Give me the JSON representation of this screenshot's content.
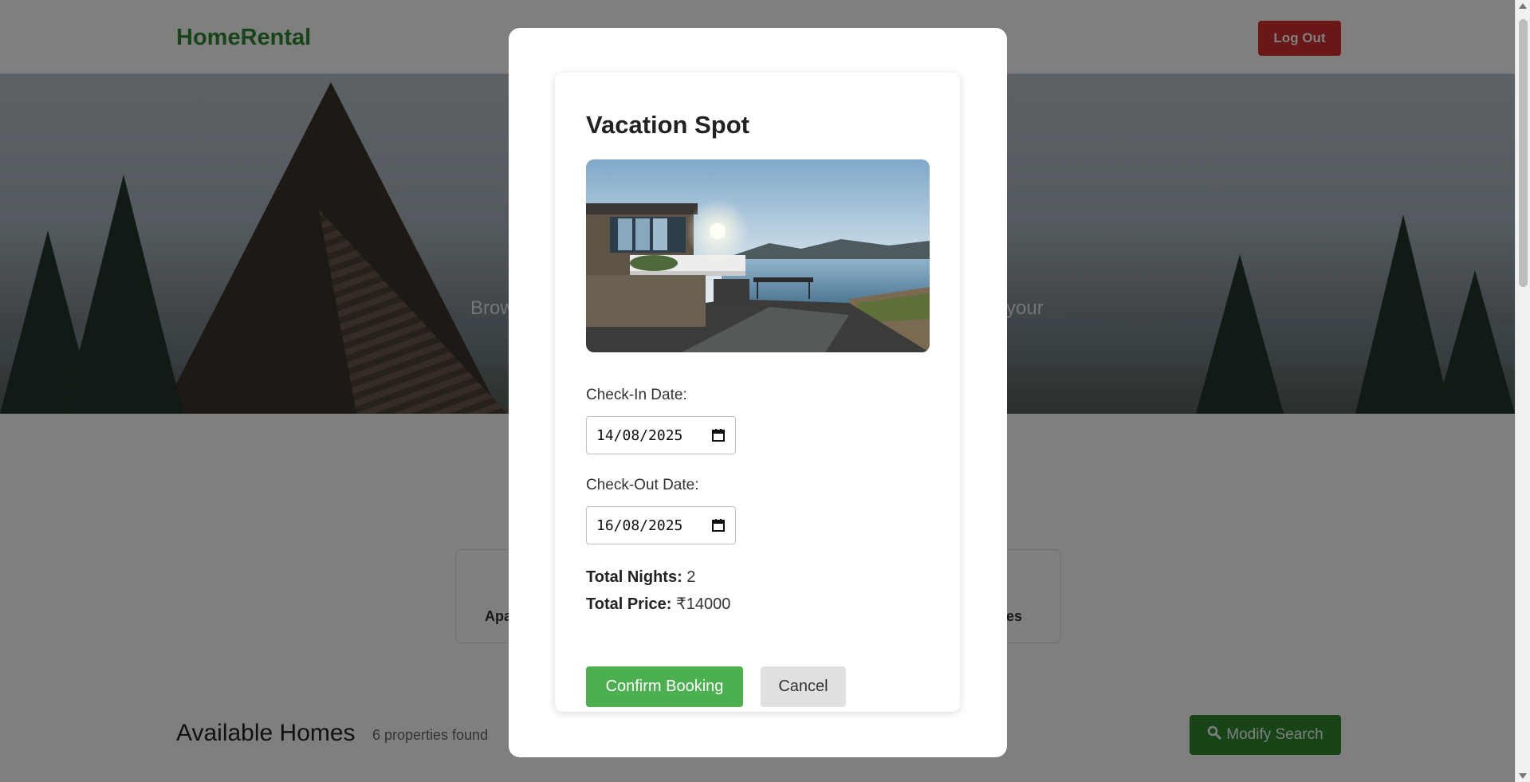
{
  "navbar": {
    "brand": "HomeRental",
    "logout_label": "Log Out"
  },
  "hero": {
    "text_left": "Brow",
    "text_right": "your"
  },
  "categories": {
    "left_label": "Apa",
    "right_label": "es"
  },
  "listing": {
    "title": "Available Homes",
    "count": "6 properties found",
    "modify_label": "Modify Search",
    "modify_icon": "search-icon"
  },
  "modal": {
    "title": "Vacation Spot",
    "photo": "vacation-home-photo",
    "checkin_label": "Check-In Date:",
    "checkin_value": "14/08/2025",
    "checkout_label": "Check-Out Date:",
    "checkout_value": "16/08/2025",
    "nights_label": "Total Nights:",
    "nights_value": "2",
    "price_label": "Total Price:",
    "price_value": "₹14000",
    "confirm_label": "Confirm Booking",
    "cancel_label": "Cancel"
  },
  "colors": {
    "brand": "#2e8b2e",
    "confirm": "#4caf50",
    "logout": "#d32f2f",
    "cancel": "#e0e0e0"
  }
}
